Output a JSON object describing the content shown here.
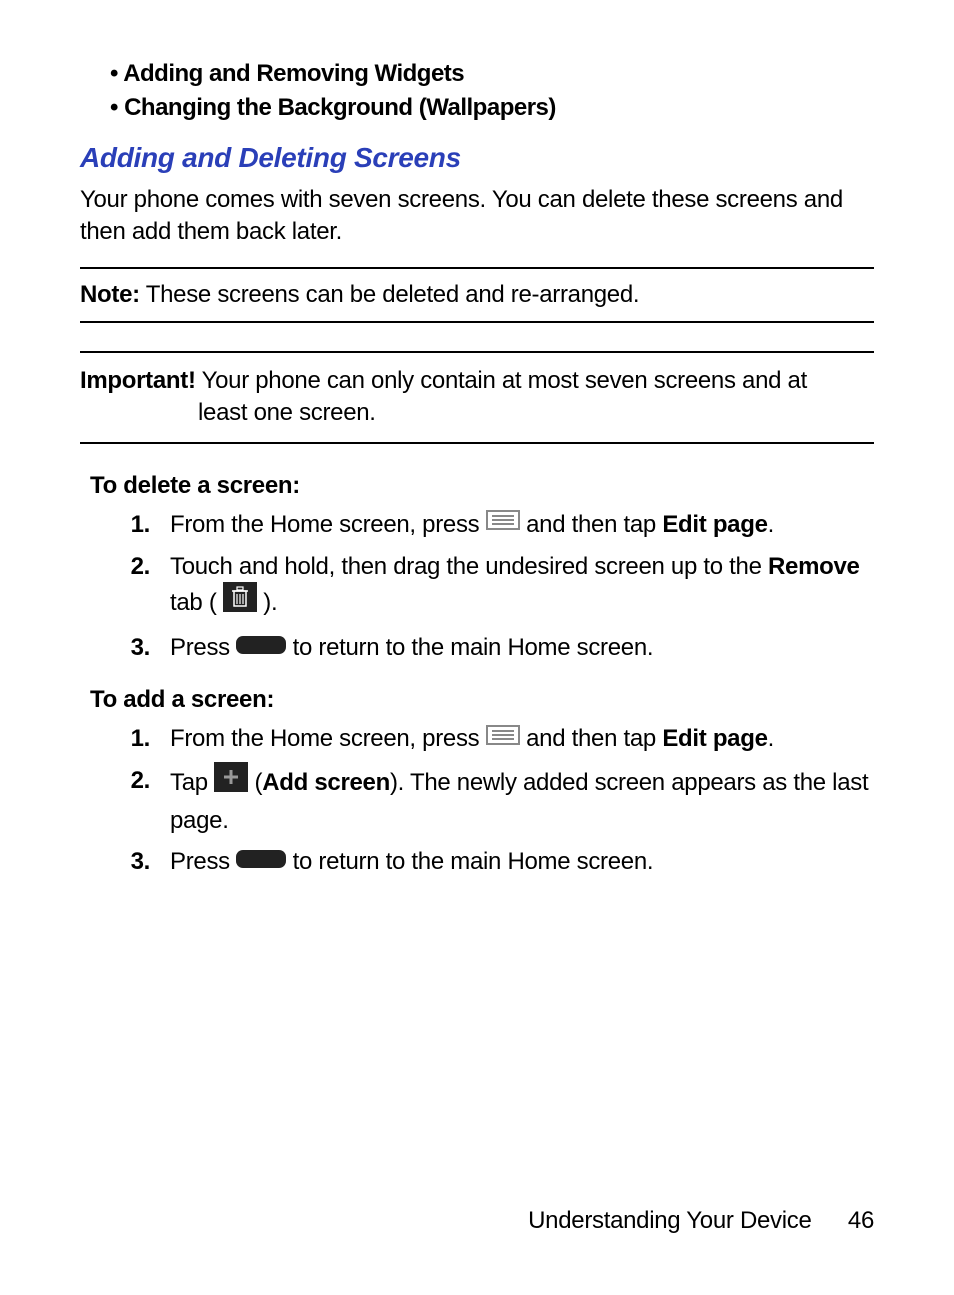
{
  "bullets": [
    "Adding and Removing Widgets",
    "Changing the Background (Wallpapers)"
  ],
  "heading": "Adding and Deleting Screens",
  "intro": "Your phone comes with seven screens. You can delete these screens and then add them back later.",
  "note": {
    "label": "Note:",
    "text": "These screens can be deleted and re-arranged."
  },
  "important": {
    "label": "Important!",
    "line1": "Your phone can only contain at most seven screens and at",
    "line2": "least one screen."
  },
  "delete": {
    "heading": "To delete a screen:",
    "steps": {
      "s1a": "From the Home screen, press ",
      "s1b": " and then tap ",
      "s1c": "Edit page",
      "s1d": ".",
      "s2a": "Touch and hold, then drag the undesired screen up to the ",
      "s2b": "Remove",
      "s2c": " tab (",
      "s2d": ").",
      "s3a": "Press ",
      "s3b": " to return to the main Home screen."
    }
  },
  "add": {
    "heading": "To add a screen:",
    "steps": {
      "s1a": "From the Home screen, press ",
      "s1b": " and then tap ",
      "s1c": "Edit page",
      "s1d": ".",
      "s2a": "Tap ",
      "s2b": " (",
      "s2c": "Add screen",
      "s2d": "). The newly added screen appears as the last page.",
      "s3a": "Press ",
      "s3b": " to return to the main Home screen."
    }
  },
  "footer": {
    "section": "Understanding Your Device",
    "page": "46"
  }
}
